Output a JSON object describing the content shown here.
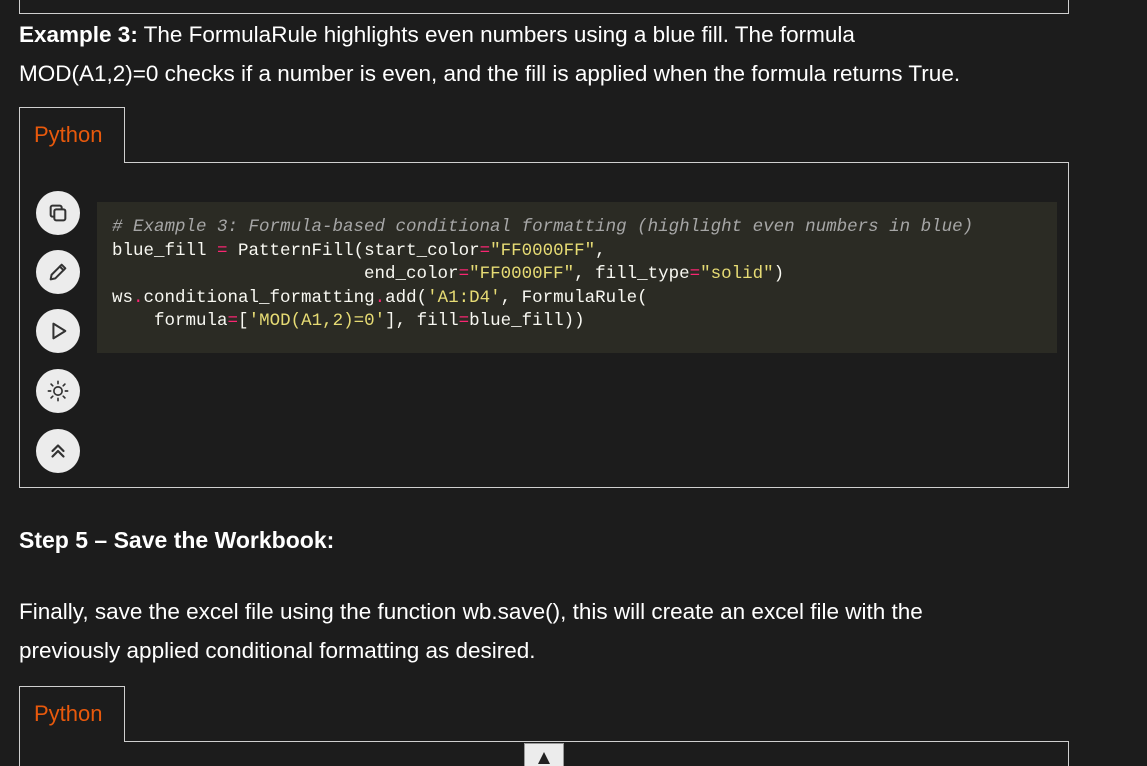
{
  "example3": {
    "label": "Example 3:",
    "text_line1": " The FormulaRule highlights even numbers using a blue fill. The formula",
    "text_line2": "MOD(A1,2)=0 checks if a number is even, and the fill is applied when the formula returns True."
  },
  "code_block_1": {
    "language_tab": "Python",
    "toolbar": {
      "copy_icon": "copy-icon",
      "edit_icon": "pencil-icon",
      "run_icon": "play-icon",
      "theme_icon": "sun-icon",
      "collapse_icon": "double-chevron-up-icon"
    },
    "lines": {
      "l1_comment": "# Example 3: Formula-based conditional formatting (highlight even numbers in blue)",
      "l2_a": "blue_fill ",
      "l2_eq": "=",
      "l2_b": " PatternFill(start_color",
      "l2_eq2": "=",
      "l2_str": "\"FF0000FF\"",
      "l2_c": ",",
      "l3_a": "                        end_color",
      "l3_eq": "=",
      "l3_str": "\"FF0000FF\"",
      "l3_b": ", fill_type",
      "l3_eq2": "=",
      "l3_str2": "\"solid\"",
      "l3_c": ")",
      "l4_a": "ws",
      "l4_dot": ".",
      "l4_b": "conditional_formatting",
      "l4_dot2": ".",
      "l4_c": "add(",
      "l4_str": "'A1:D4'",
      "l4_d": ", FormulaRule(",
      "l5_a": "    formula",
      "l5_eq": "=",
      "l5_b": "[",
      "l5_str": "'MOD(A1,2)=0'",
      "l5_c": "], fill",
      "l5_eq2": "=",
      "l5_d": "blue_fill))"
    }
  },
  "step5": {
    "heading": "Step 5 – Save the Workbook:"
  },
  "finally": {
    "line1": "Finally, save the excel file using the function wb.save(), this will create an excel file with the",
    "line2": "previously applied conditional formatting as desired."
  },
  "code_block_2": {
    "language_tab": "Python"
  },
  "scroll_top_icon": "caret-up-icon",
  "colors": {
    "background": "#1c1c1c",
    "tab_text": "#e8590c",
    "code_bg": "#2b2b24",
    "button_bg": "#ececec"
  }
}
